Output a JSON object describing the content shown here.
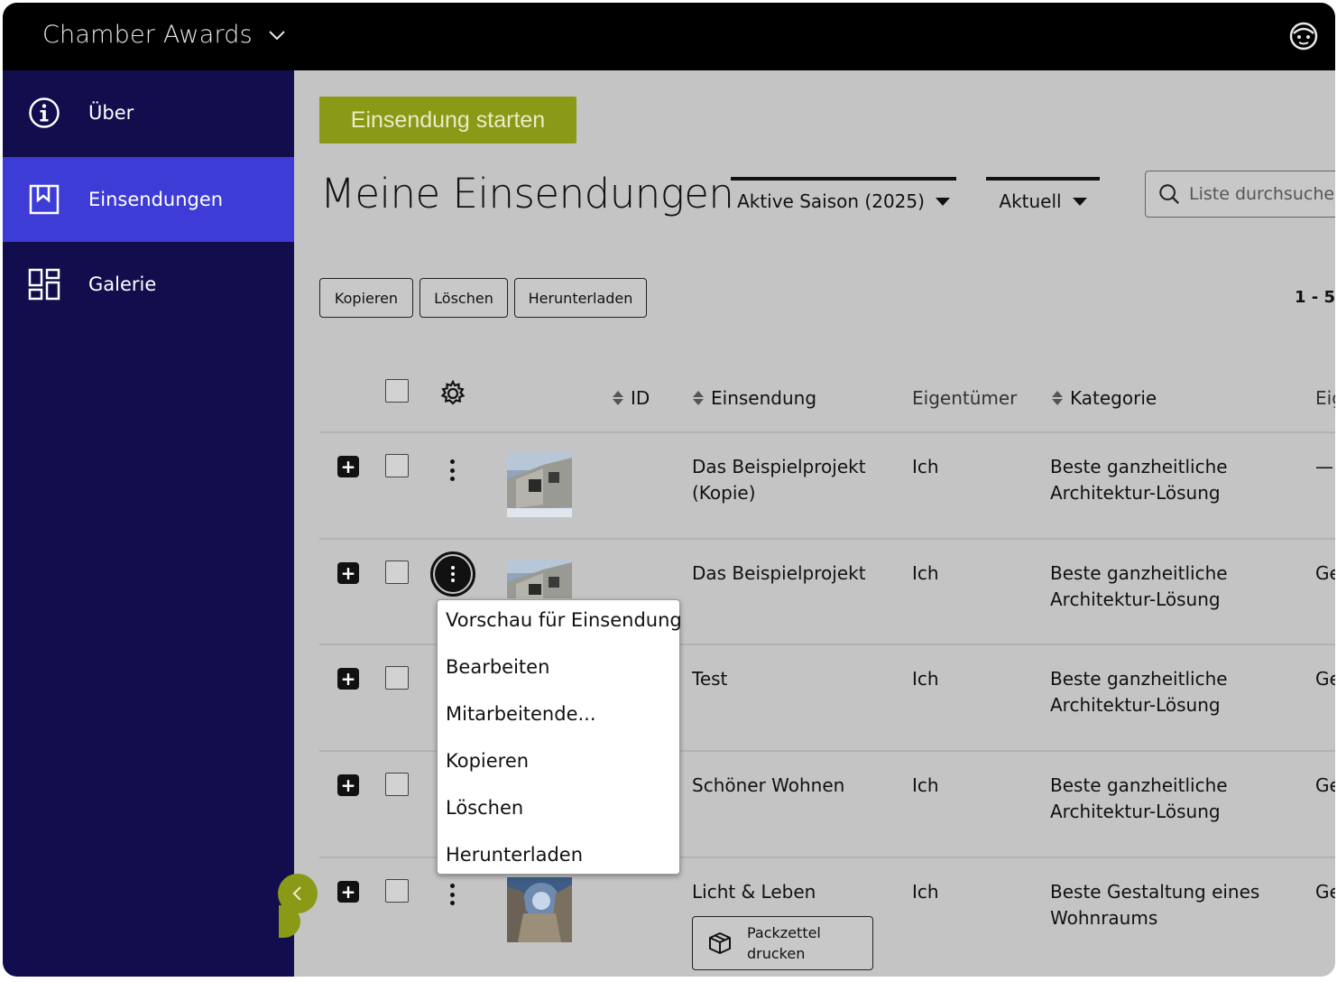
{
  "app": {
    "title": "Chamber Awards"
  },
  "sidebar": {
    "items": [
      {
        "label": "Über",
        "icon": "info-icon"
      },
      {
        "label": "Einsendungen",
        "icon": "bookmark-icon",
        "active": true
      },
      {
        "label": "Galerie",
        "icon": "gallery-grid-icon"
      }
    ]
  },
  "main": {
    "start_button": "Einsendung starten",
    "title": "Meine Einsendungen",
    "season_filter": "Aktive Saison (2025)",
    "status_filter": "Aktuell",
    "search_placeholder": "Liste durchsuchen"
  },
  "toolbar": {
    "copy": "Kopieren",
    "delete": "Löschen",
    "download": "Herunterladen",
    "pager": "1 - 5"
  },
  "table": {
    "headers": {
      "id": "ID",
      "submission": "Einsendung",
      "owner": "Eigentümer",
      "category": "Kategorie",
      "next": "Eig"
    },
    "rows": [
      {
        "submission_line1": "Das Beispielprojekt",
        "submission_line2": "(Kopie)",
        "owner": "Ich",
        "category_line1": "Beste ganzheitliche",
        "category_line2": "Architektur-Lösung",
        "next": "—"
      },
      {
        "submission_line1": "Das Beispielprojekt",
        "submission_line2": "",
        "owner": "Ich",
        "category_line1": "Beste ganzheitliche",
        "category_line2": "Architektur-Lösung",
        "next": "Ge"
      },
      {
        "submission_line1": "Test",
        "submission_line2": "",
        "owner": "Ich",
        "category_line1": "Beste ganzheitliche",
        "category_line2": "Architektur-Lösung",
        "next": "Ge"
      },
      {
        "submission_line1": "Schöner Wohnen",
        "submission_line2": "",
        "owner": "Ich",
        "category_line1": "Beste ganzheitliche",
        "category_line2": "Architektur-Lösung",
        "next": "Ge"
      },
      {
        "submission_line1": "Licht & Leben",
        "submission_line2": "",
        "owner": "Ich",
        "category_line1": "Beste Gestaltung eines",
        "category_line2": "Wohnraums",
        "next": "Ge"
      }
    ],
    "pack_button": "Packzettel\ndrucken"
  },
  "context_menu": {
    "items": [
      "Vorschau für Einsendung",
      "Bearbeiten",
      "Mitarbeitende...",
      "Kopieren",
      "Löschen",
      "Herunterladen"
    ]
  },
  "colors": {
    "accent": "#8a9a16",
    "sidebar": "#120e4e",
    "sidebar_active": "#3d3cd6"
  }
}
